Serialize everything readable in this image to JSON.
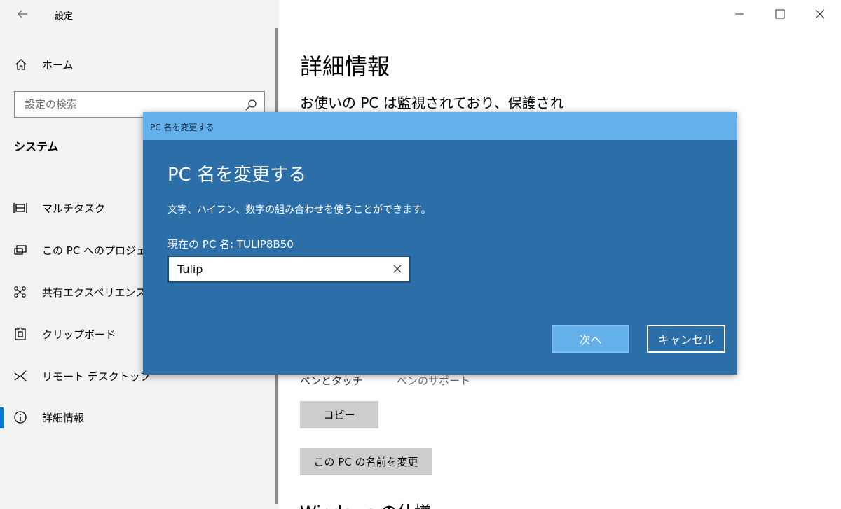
{
  "window": {
    "title": "設定"
  },
  "sidebar": {
    "home_label": "ホーム",
    "search_placeholder": "設定の検索",
    "section_heading": "システム",
    "items": [
      {
        "label": "マルチタスク",
        "icon": "multitask-icon"
      },
      {
        "label": "この PC へのプロジェク",
        "icon": "project-icon"
      },
      {
        "label": "共有エクスペリエンス",
        "icon": "shared-experience-icon"
      },
      {
        "label": "クリップボード",
        "icon": "clipboard-icon"
      },
      {
        "label": "リモート デスクトップ",
        "icon": "remote-desktop-icon"
      },
      {
        "label": "詳細情報",
        "icon": "info-icon",
        "selected": true
      }
    ]
  },
  "main": {
    "title": "詳細情報",
    "subheading": "お使いの PC は監視されており、保護され",
    "pen_label": "ペンとタッチ",
    "pen_value": "ペンのサポート",
    "copy_button": "コピー",
    "rename_button": "この PC の名前を変更",
    "windows_spec": "Windows の仕様"
  },
  "dialog": {
    "titlebar": "PC 名を変更する",
    "heading": "PC 名を変更する",
    "description": "文字、ハイフン、数字の組み合わせを使うことができます。",
    "current_name": "現在の PC 名: TULIP8B50",
    "input_value": "Tulip",
    "next_button": "次へ",
    "cancel_button": "キャンセル"
  },
  "colors": {
    "dialog_bg": "#2b6ea8",
    "dialog_titlebar": "#63b0eb",
    "accent": "#0078d7",
    "sidebar_bg": "#f2f2f2"
  }
}
